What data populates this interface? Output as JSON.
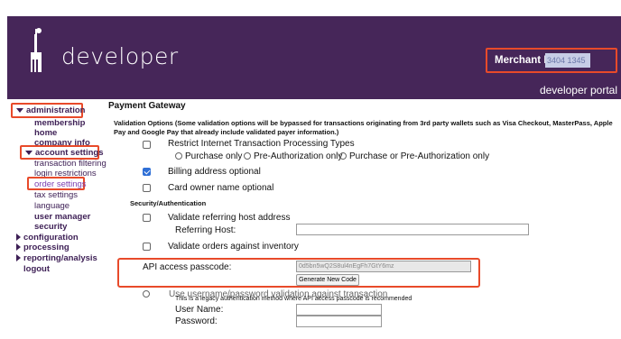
{
  "header": {
    "logo_text": "developer",
    "merchant_label": "Merchant ID:",
    "merchant_value": "3404 1345",
    "portal_text": "developer portal"
  },
  "sidebar": {
    "administration": "administration",
    "membership_home_1": "membership",
    "membership_home_2": "home",
    "company_info": "company info",
    "account_settings": "account settings",
    "transaction_filtering": "transaction filtering",
    "login_restrictions": "login restrictions",
    "order_settings": "order settings",
    "tax_settings": "tax settings",
    "language": "language",
    "user_manager": "user manager",
    "security": "security",
    "configuration": "configuration",
    "processing": "processing",
    "reporting_analysis": "reporting/analysis",
    "logout": "logout"
  },
  "main": {
    "title": "Payment Gateway",
    "validation_options": "Validation Options  (Some validation options will be bypassed for transactions originating from 3rd party wallets such as Visa Checkout, MasterPass, Apple Pay and Google Pay that already include validated payer information.)",
    "restrict_label": "Restrict Internet Transaction Processing Types",
    "radio_purchase_only": "Purchase only",
    "radio_preauth_only": "Pre-Authorization only",
    "radio_purchase_or_preauth": "Purchase or Pre-Authorization only",
    "billing_optional": "Billing address optional",
    "card_owner_optional": "Card owner name optional",
    "security_auth": "Security/Authentication",
    "validate_referring": "Validate referring host address",
    "referring_host_label": "Referring Host:",
    "validate_orders": "Validate orders against inventory",
    "api_passcode_label": "API access passcode:",
    "api_passcode_value": "0d5bn5wQ2S8ul4nEgFh7GtY6mz",
    "generate_button": "Generate New Code",
    "use_username": "Use username/password validation against transaction",
    "legacy_note": "This is a legacy authentication method where API access passcode is recommended",
    "user_name_label": "User Name:",
    "password_label": "Password:"
  },
  "colors": {
    "header_bg": "#462659",
    "highlight": "#e84a2a",
    "nav": "#3d1f55",
    "checkbox_checked": "#2f6fd6"
  }
}
